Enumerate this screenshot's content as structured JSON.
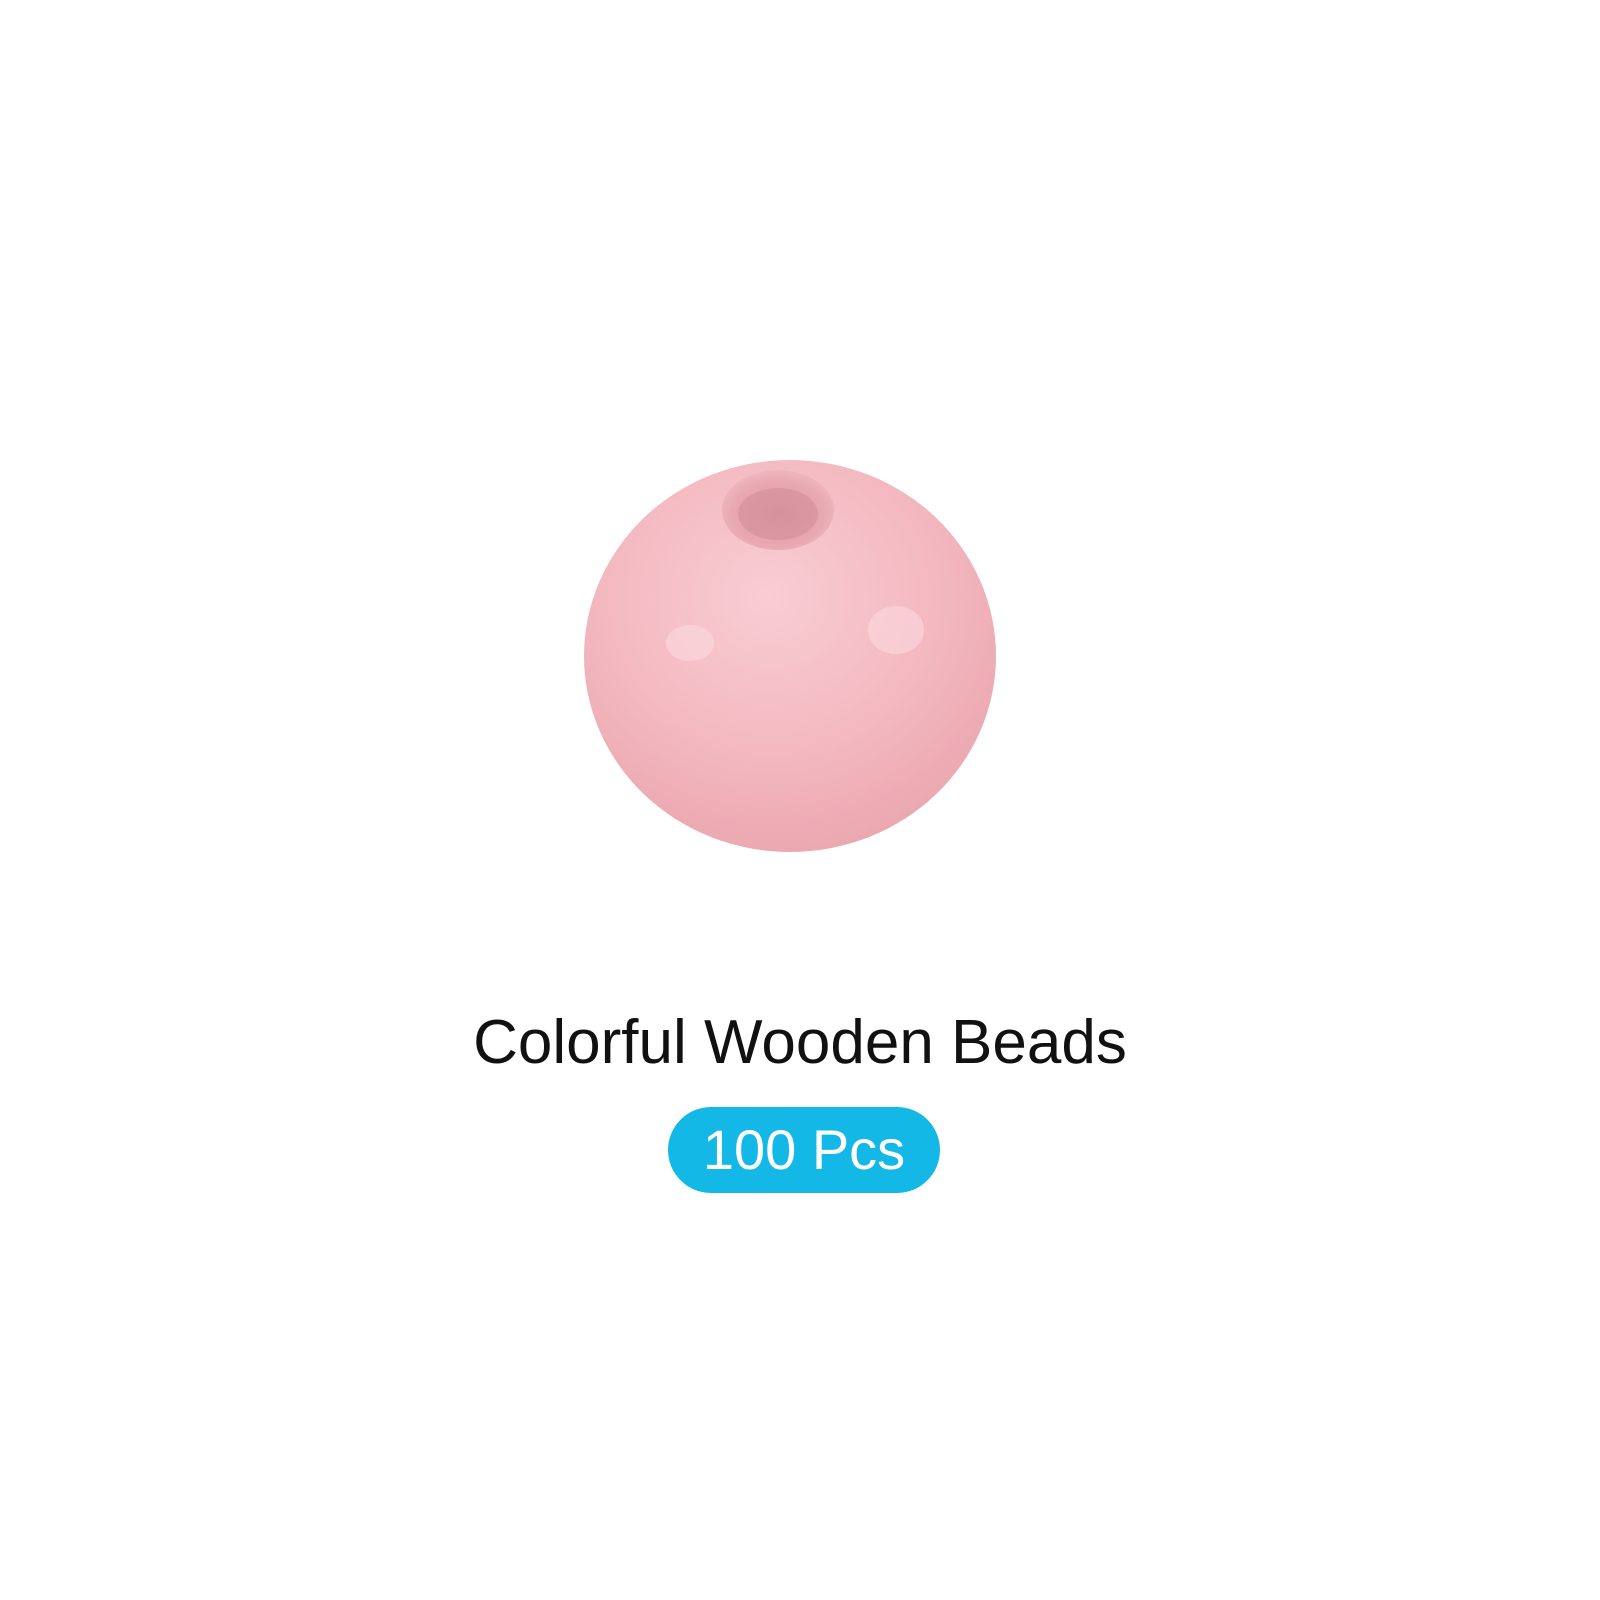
{
  "product": {
    "title": "Colorful Wooden Beads",
    "badge_label": "100 Pcs",
    "badge_color": "#14b8e6",
    "bead_color": "#f4b9c1",
    "bead_icon": "pink-wooden-bead-icon"
  }
}
